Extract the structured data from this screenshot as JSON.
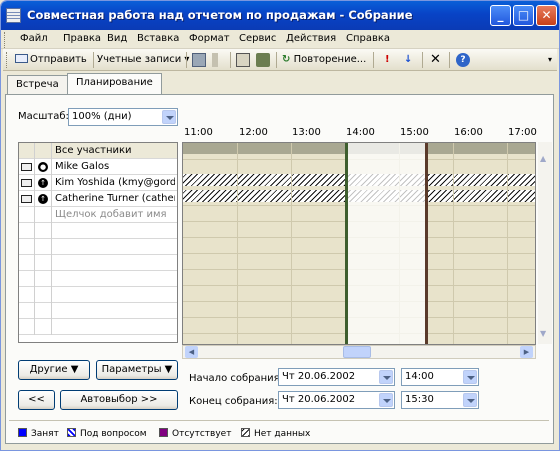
{
  "window": {
    "title": "Совместная работа над отчетом по продажам - Собрание"
  },
  "menu": [
    "Файл",
    "Правка",
    "Вид",
    "Вставка",
    "Формат",
    "Сервис",
    "Действия",
    "Справка"
  ],
  "toolbar": {
    "send": "Отправить",
    "accounts": "Учетные записи",
    "recurrence": "Повторение..."
  },
  "tabs": [
    "Встреча",
    "Планирование"
  ],
  "zoom": {
    "label": "Масштаб:",
    "value": "100% (дни)"
  },
  "attendees": {
    "header": "Все участники",
    "items": [
      "Mike Galos",
      "Kim Yoshida (kmy@gordcnc",
      "Catherine Turner (catherne"
    ],
    "add_hint": "Щелчок добавит имя"
  },
  "times": [
    "11:00",
    "12:00",
    "13:00",
    "14:00",
    "15:00",
    "16:00",
    "17:00"
  ],
  "buttons": {
    "others": "Другие",
    "options": "Параметры",
    "prev": "<<",
    "autopick": "Автовыбор >>"
  },
  "meeting": {
    "start_label": "Начало собрания:",
    "end_label": "Конец собрания:",
    "start_date": "Чт 20.06.2002",
    "start_time": "14:00",
    "end_date": "Чт 20.06.2002",
    "end_time": "15:30"
  },
  "legend": {
    "busy": "Занят",
    "tentative": "Под вопросом",
    "away": "Отсутствует",
    "nodata": "Нет данных"
  },
  "colors": {
    "busy": "#0000ff",
    "tentative": "#6a8cff",
    "away": "#800080",
    "nodata": "#ffffff",
    "selection": "#3e5e2e"
  }
}
